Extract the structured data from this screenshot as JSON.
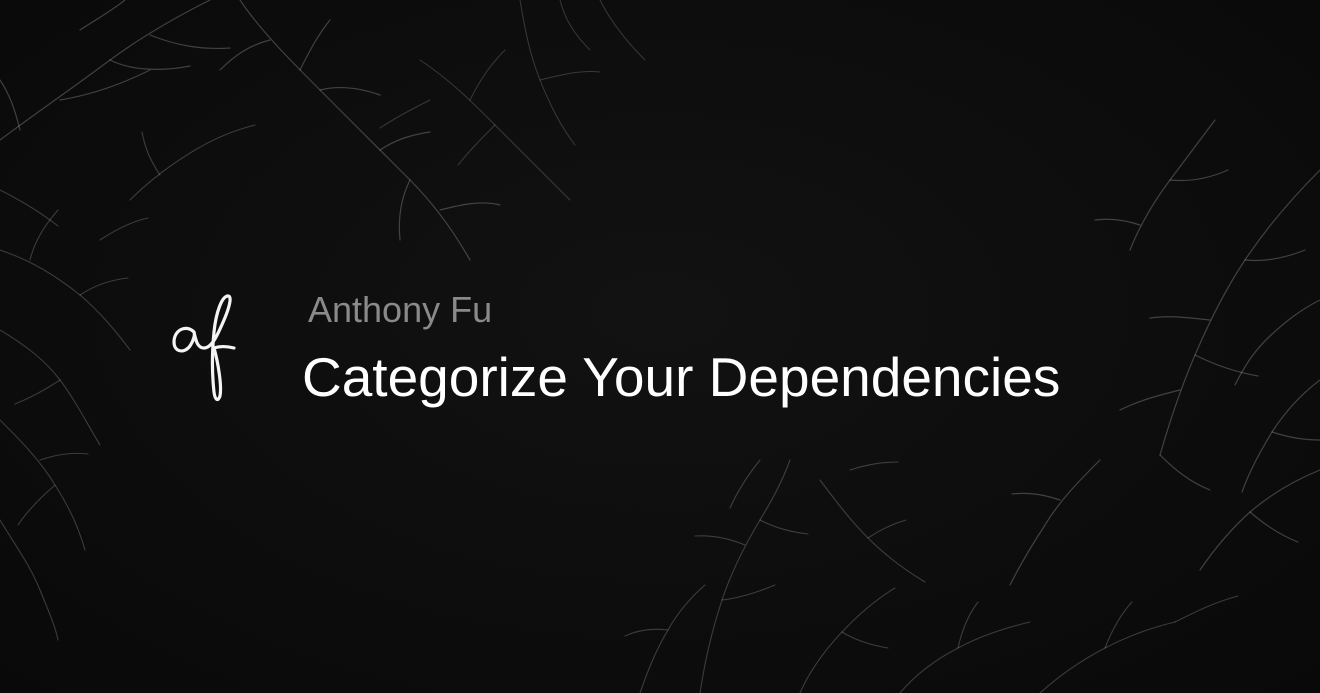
{
  "card": {
    "author": "Anthony Fu",
    "title": "Categorize Your Dependencies",
    "logo_icon": "af-signature-logo",
    "decoration": "plum-branch-pattern"
  },
  "colors": {
    "background": "#0d0d0d",
    "title_text": "#ffffff",
    "author_text": "#8a8a8a",
    "branch_stroke": "#ffffff"
  }
}
